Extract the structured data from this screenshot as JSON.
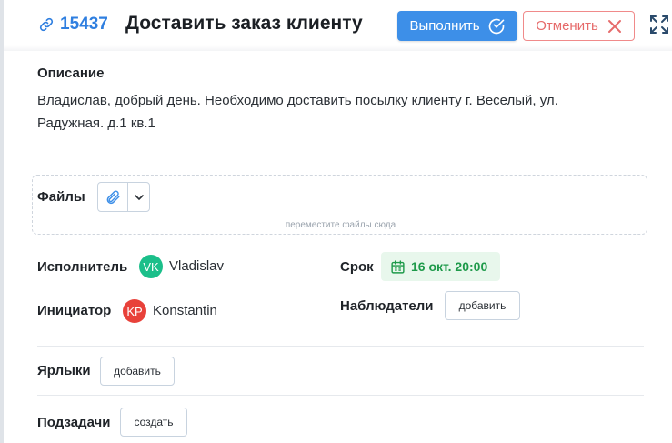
{
  "header": {
    "task_id": "15437",
    "title": "Доставить заказ клиенту",
    "done_label": "Выполнить",
    "cancel_label": "Отменить"
  },
  "description": {
    "label": "Описание",
    "text": "Владислав, добрый день. Необходимо доставить посылку клиенту г. Веселый, ул. Радужная. д.1 кв.1"
  },
  "files": {
    "label": "Файлы",
    "drop_hint": "переместите файлы сюда"
  },
  "assignee": {
    "label": "Исполнитель",
    "initials": "VK",
    "name": "Vladislav",
    "avatar_color": "#1bbf8a"
  },
  "initiator": {
    "label": "Инициатор",
    "initials": "KP",
    "name": "Konstantin",
    "avatar_color": "#e8413a"
  },
  "deadline": {
    "label": "Срок",
    "value": "16 окт. 20:00"
  },
  "watchers": {
    "label": "Наблюдатели",
    "add_label": "добавить"
  },
  "tags": {
    "label": "Ярлыки",
    "add_label": "добавить"
  },
  "subtasks": {
    "label": "Подзадачи",
    "create_label": "создать"
  },
  "colors": {
    "accent": "#3d8fe8",
    "cancel": "#e66b6b",
    "deadline_bg": "#e8f7ec",
    "deadline_text": "#1e9a4a"
  },
  "icons": [
    "link-icon",
    "check-circle-icon",
    "close-icon",
    "expand-icon",
    "paperclip-icon",
    "chevron-down-icon",
    "calendar-icon"
  ]
}
